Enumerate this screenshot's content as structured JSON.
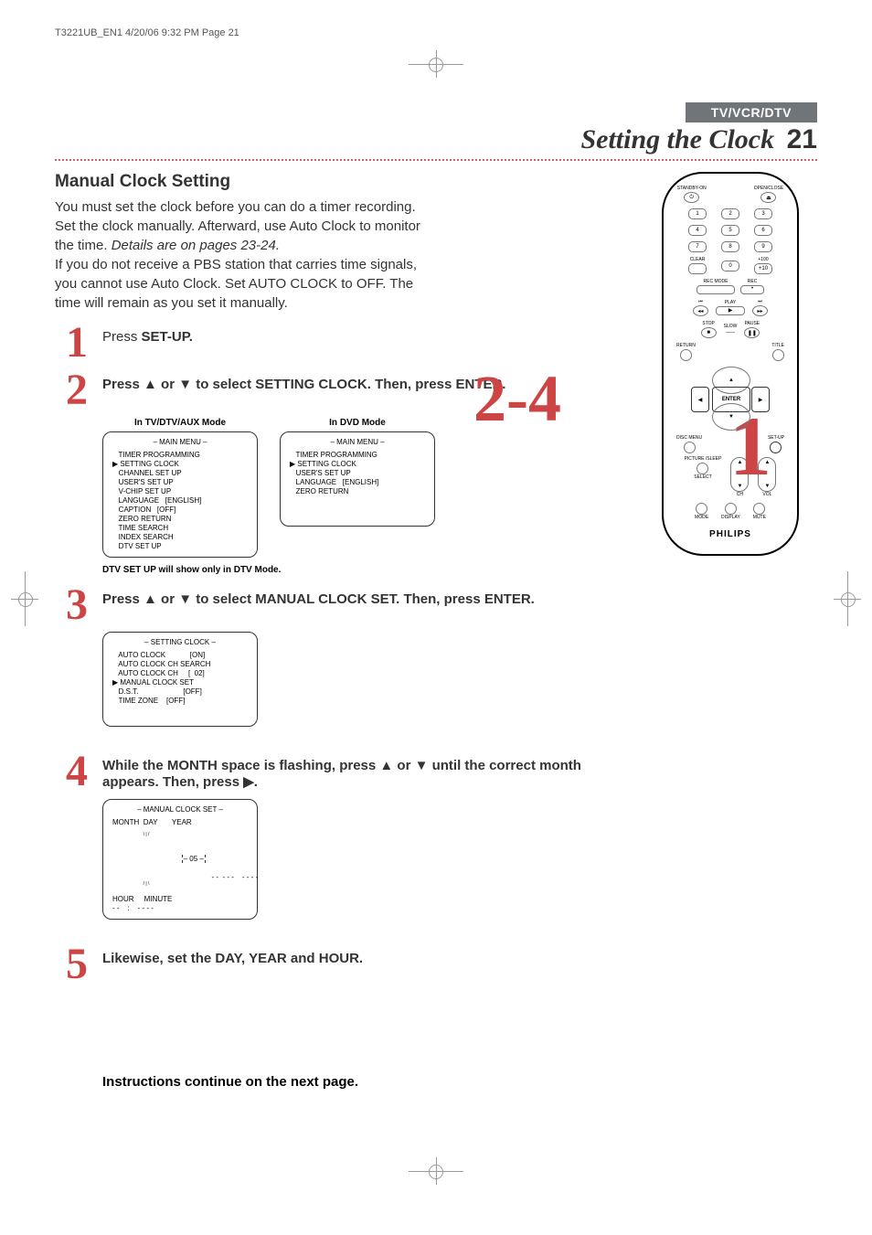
{
  "header_line": "T3221UB_EN1  4/20/06  9:32 PM  Page 21",
  "badge": "TV/VCR/DTV",
  "page_title": "Setting the Clock",
  "page_number": "21",
  "section_title": "Manual Clock Setting",
  "intro_p1_a": "You must set the clock before you can do a timer recording. Set the clock manually. Afterward, use Auto Clock to monitor the time. ",
  "intro_p1_b": "Details are on pages 23-24.",
  "intro_p2": "If you do not receive a PBS station that carries time signals, you cannot use Auto Clock. Set AUTO CLOCK to OFF. The time will remain as you set it manually.",
  "big_callout": "2-4",
  "big_callout2": "1",
  "step1": {
    "num": "1",
    "text_a": "Press ",
    "text_b": "SET-UP."
  },
  "step2": {
    "num": "2",
    "text": "Press ▲ or ▼ to select SETTING CLOCK. Then, press ENTER.",
    "col1_label": "In TV/DTV/AUX Mode",
    "col2_label": "In DVD Mode",
    "menu1": {
      "title": "– MAIN MENU –",
      "items": [
        "TIMER PROGRAMMING",
        "SETTING CLOCK",
        "CHANNEL SET UP",
        "USER'S SET UP",
        "V-CHIP SET UP",
        "LANGUAGE   [ENGLISH]",
        "CAPTION   [OFF]",
        "ZERO RETURN",
        "TIME SEARCH",
        "INDEX SEARCH",
        "DTV SET UP"
      ]
    },
    "menu2": {
      "title": "– MAIN MENU –",
      "items": [
        "TIMER PROGRAMMING",
        "SETTING CLOCK",
        "USER'S SET UP",
        "LANGUAGE   [ENGLISH]",
        "ZERO RETURN"
      ]
    },
    "note": "DTV SET UP will show only in DTV Mode."
  },
  "step3": {
    "num": "3",
    "text": "Press ▲ or ▼ to select MANUAL CLOCK SET. Then, press ENTER.",
    "menu": {
      "title": "– SETTING CLOCK –",
      "items": [
        "AUTO CLOCK            [ON]",
        "AUTO CLOCK CH SEARCH",
        "AUTO CLOCK CH     [  02]",
        "MANUAL CLOCK SET",
        "D.S.T.                      [OFF]",
        "TIME ZONE    [OFF]"
      ]
    }
  },
  "step4": {
    "num": "4",
    "text": "While the MONTH space is flashing, press ▲ or ▼ until the correct month appears. Then, press ▶.",
    "menu": {
      "title": "– MANUAL CLOCK SET –",
      "header": "MONTH  DAY       YEAR",
      "month_val": "05",
      "row1_rest": "   - -  - - -    - - - -",
      "header2": "HOUR     MINUTE",
      "row2": "- -    :    - - - -"
    }
  },
  "step5": {
    "num": "5",
    "text": "Likewise, set the DAY, YEAR and HOUR."
  },
  "continue": "Instructions continue on the next page.",
  "remote": {
    "standby": "STANDBY-ON",
    "openclose": "OPEN/CLOSE",
    "clear": "CLEAR",
    "plus100": "+100",
    "recmode": "REC MODE",
    "rec": "REC",
    "play": "PLAY",
    "stop": "STOP",
    "slow": "SLOW",
    "pause": "PAUSE",
    "return": "RETURN",
    "title": "TITLE",
    "enter": "ENTER",
    "disc": "DISC MENU",
    "setup": "SET-UP",
    "picture": "PICTURE /SLEEP",
    "ch": "CH",
    "vol": "VOL",
    "select": "SELECT",
    "mode": "MODE",
    "display": "DISPLAY",
    "mute": "MUTE",
    "brand": "PHILIPS",
    "b1": "1",
    "b2": "2",
    "b3": "3",
    "b4": "4",
    "b5": "5",
    "b6": "6",
    "b7": "7",
    "b8": "8",
    "b9": "9",
    "b0": "0",
    "b10": "+10"
  }
}
